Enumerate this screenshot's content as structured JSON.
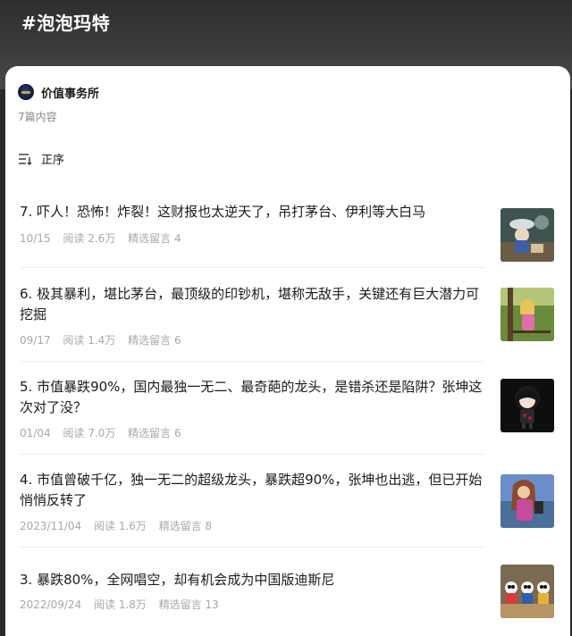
{
  "header": {
    "hashtag": "#泡泡玛特"
  },
  "author": {
    "name": "价值事务所",
    "count": "7篇内容"
  },
  "sort": {
    "label": "正序",
    "icon": "sort-icon"
  },
  "articles": [
    {
      "title": "7. 吓人！恐怖！炸裂！这财报也太逆天了，吊打茅台、伊利等大白马",
      "date": "10/15",
      "reads": "阅读 2.6万",
      "comments": "精选留言 4",
      "thumb": "doll-umbrella-image"
    },
    {
      "title": "6. 极其暴利，堪比茅台，最顶级的印钞机，堪称无敌手，关键还有巨大潜力可挖掘",
      "date": "09/17",
      "reads": "阅读 1.4万",
      "comments": "精选留言 6",
      "thumb": "doll-swing-image"
    },
    {
      "title": "5. 市值暴跌90%，国内最独一无二、最奇葩的龙头，是错杀还是陷阱？张坤这次对了没？",
      "date": "01/04",
      "reads": "阅读 7.0万",
      "comments": "精选留言 6",
      "thumb": "figure-black-hair-image"
    },
    {
      "title": "4. 市值曾破千亿，独一无二的超级龙头，暴跌超90%，张坤也出逃，但已开始悄悄反转了",
      "date": "2023/11/04",
      "reads": "阅读 1.6万",
      "comments": "精选留言 8",
      "thumb": "doll-barbie-image"
    },
    {
      "title": "3. 暴跌80%，全网唱空，却有机会成为中国版迪斯尼",
      "date": "2022/09/24",
      "reads": "阅读 1.8万",
      "comments": "精选留言 13",
      "thumb": "toy-figures-image"
    }
  ]
}
